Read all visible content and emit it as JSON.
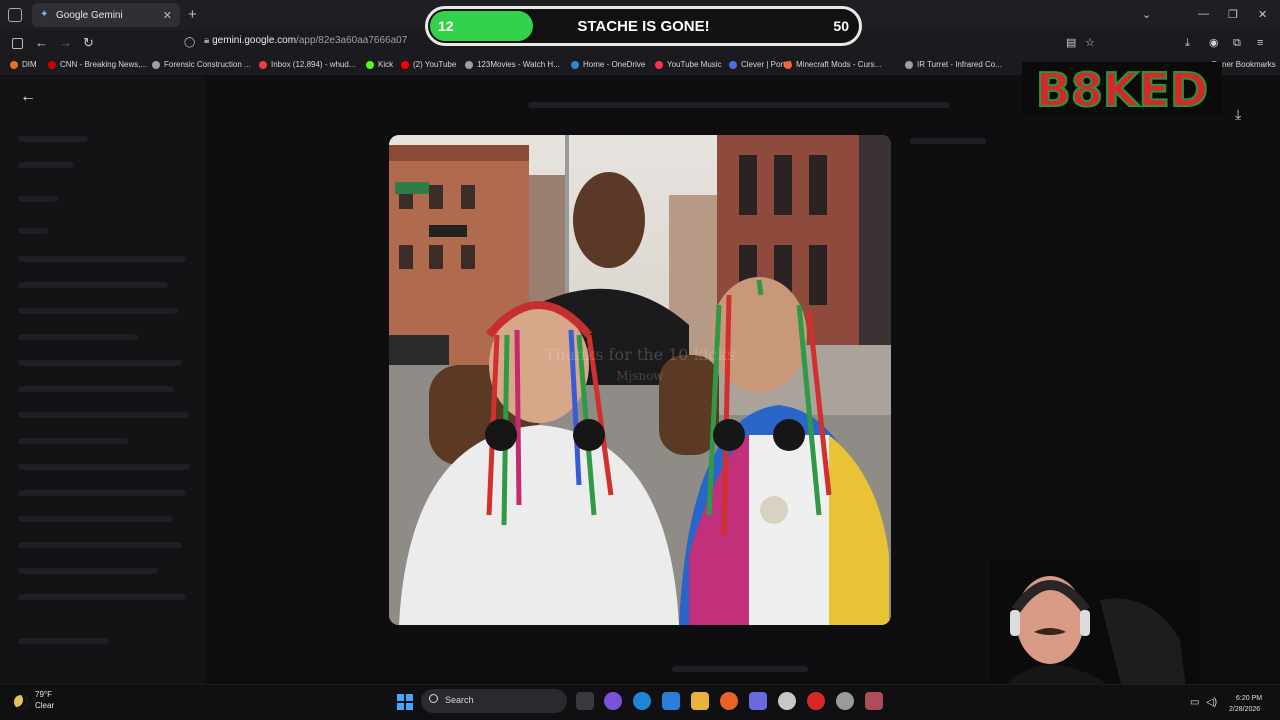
{
  "browser": {
    "tab_title": "Google Gemini",
    "url_host": "gemini.google.com",
    "url_path": "/app/82e3a60aa7666a07",
    "bookmarks": [
      {
        "label": "DIM",
        "color": "#e8702a"
      },
      {
        "label": "CNN - Breaking News,...",
        "color": "#cc0000"
      },
      {
        "label": "Forensic Construction ...",
        "color": "#9aa0a6"
      },
      {
        "label": "Inbox (12,894) - whud...",
        "color": "#ea4335"
      },
      {
        "label": "Kick",
        "color": "#53fc18"
      },
      {
        "label": "(2) YouTube",
        "color": "#ff0000"
      },
      {
        "label": "123Movies - Watch H...",
        "color": "#9aa0a6"
      },
      {
        "label": "Home - OneDrive",
        "color": "#2b88d8"
      },
      {
        "label": "YouTube Music",
        "color": "#ff2d55"
      },
      {
        "label": "Clever | Portal",
        "color": "#4f6bed"
      },
      {
        "label": "Minecraft Mods - Curs...",
        "color": "#f16436"
      },
      {
        "label": "IR Turret - Infrared Co...",
        "color": "#9aa0a6"
      },
      {
        "label": "ner Bookmarks",
        "color": "#9aa0a6"
      }
    ]
  },
  "viewer": {
    "watermark_line1": "Thanks for the 10 kicks",
    "watermark_line2": "Mjsnow"
  },
  "overlay": {
    "goal_current": "12",
    "goal_target": "50",
    "goal_fraction": 0.24,
    "goal_title": "STACHE IS GONE!",
    "logo_text": "B8KED"
  },
  "taskbar": {
    "temperature": "79°F",
    "condition": "Clear",
    "search_label": "Search",
    "time": "6:20 PM",
    "date": "2/28/2026"
  },
  "colors": {
    "goal_fill": "#34d24a",
    "logo_green": "#1f9a3a",
    "logo_yellow": "#f2c230",
    "logo_red": "#d8262b"
  }
}
